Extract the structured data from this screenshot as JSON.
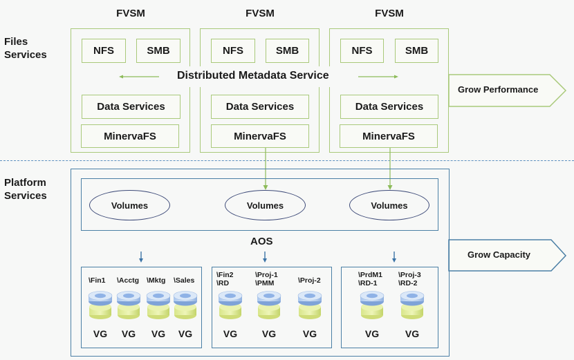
{
  "sections": {
    "files_services": "Files\nServices",
    "platform_services": "Platform\nServices"
  },
  "fvsm_nodes": [
    {
      "title": "FVSM",
      "nfs": "NFS",
      "smb": "SMB",
      "data_services": "Data Services",
      "minervafs": "MinervaFS"
    },
    {
      "title": "FVSM",
      "nfs": "NFS",
      "smb": "SMB",
      "data_services": "Data Services",
      "minervafs": "MinervaFS"
    },
    {
      "title": "FVSM",
      "nfs": "NFS",
      "smb": "SMB",
      "data_services": "Data Services",
      "minervafs": "MinervaFS"
    }
  ],
  "distributed_metadata": "Distributed Metadata Service",
  "grow_performance": "Grow Performance",
  "grow_capacity": "Grow Capacity",
  "volumes": [
    "Volumes",
    "Volumes",
    "Volumes"
  ],
  "aos_label": "AOS",
  "volume_groups": [
    {
      "items": [
        {
          "path": "\\Fin1",
          "label": "VG"
        },
        {
          "path": "\\Acctg",
          "label": "VG"
        },
        {
          "path": "\\Mktg",
          "label": "VG"
        },
        {
          "path": "\\Sales",
          "label": "VG"
        }
      ]
    },
    {
      "items": [
        {
          "path": "\\Fin2\n\\RD",
          "label": "VG"
        },
        {
          "path": "\\Proj-1\n\\PMM",
          "label": "VG"
        },
        {
          "path": "\\Proj-2",
          "label": "VG"
        }
      ]
    },
    {
      "items": [
        {
          "path": "\\PrdM1\n\\RD-1",
          "label": "VG"
        },
        {
          "path": "\\Proj-3\n\\RD-2",
          "label": "VG"
        }
      ]
    }
  ],
  "colors": {
    "green_border": "#a9c97a",
    "blue_border": "#4a7fa5",
    "ellipse_border": "#3d4a78",
    "divider": "#5b8fbf"
  }
}
